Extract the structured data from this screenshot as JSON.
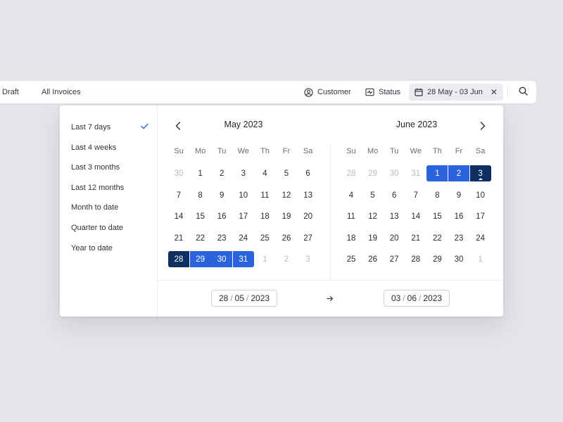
{
  "topbar": {
    "draft_label": "Draft",
    "all_invoices_label": "All Invoices",
    "customer_label": "Customer",
    "status_label": "Status",
    "date_chip_label": "28 May - 03 Jun",
    "clear_label": "✕",
    "icons": {
      "customer": "user-circle-icon",
      "status": "pulse-icon",
      "date": "calendar-icon",
      "clear": "close-icon",
      "search": "search-icon"
    }
  },
  "presets": [
    {
      "label": "Last 7 days",
      "selected": true
    },
    {
      "label": "Last 4 weeks",
      "selected": false
    },
    {
      "label": "Last 3 months",
      "selected": false
    },
    {
      "label": "Last 12 months",
      "selected": false
    },
    {
      "label": "Month to date",
      "selected": false
    },
    {
      "label": "Quarter to date",
      "selected": false
    },
    {
      "label": "Year to date",
      "selected": false
    }
  ],
  "calendar": {
    "weekdays": [
      "Su",
      "Mo",
      "Tu",
      "We",
      "Th",
      "Fr",
      "Sa"
    ],
    "months": [
      {
        "title": "May 2023",
        "weeks": [
          [
            {
              "d": "30",
              "s": "muted"
            },
            {
              "d": "1",
              "s": ""
            },
            {
              "d": "2",
              "s": ""
            },
            {
              "d": "3",
              "s": ""
            },
            {
              "d": "4",
              "s": ""
            },
            {
              "d": "5",
              "s": ""
            },
            {
              "d": "6",
              "s": ""
            }
          ],
          [
            {
              "d": "7",
              "s": ""
            },
            {
              "d": "8",
              "s": ""
            },
            {
              "d": "9",
              "s": ""
            },
            {
              "d": "10",
              "s": ""
            },
            {
              "d": "11",
              "s": ""
            },
            {
              "d": "12",
              "s": ""
            },
            {
              "d": "13",
              "s": ""
            }
          ],
          [
            {
              "d": "14",
              "s": ""
            },
            {
              "d": "15",
              "s": ""
            },
            {
              "d": "16",
              "s": ""
            },
            {
              "d": "17",
              "s": ""
            },
            {
              "d": "18",
              "s": ""
            },
            {
              "d": "19",
              "s": ""
            },
            {
              "d": "20",
              "s": ""
            }
          ],
          [
            {
              "d": "21",
              "s": ""
            },
            {
              "d": "22",
              "s": ""
            },
            {
              "d": "23",
              "s": ""
            },
            {
              "d": "24",
              "s": ""
            },
            {
              "d": "25",
              "s": ""
            },
            {
              "d": "26",
              "s": ""
            },
            {
              "d": "27",
              "s": ""
            }
          ],
          [
            {
              "d": "28",
              "s": "start"
            },
            {
              "d": "29",
              "s": "range"
            },
            {
              "d": "30",
              "s": "range"
            },
            {
              "d": "31",
              "s": "range-end"
            },
            {
              "d": "1",
              "s": "muted"
            },
            {
              "d": "2",
              "s": "muted"
            },
            {
              "d": "3",
              "s": "muted"
            }
          ]
        ]
      },
      {
        "title": "June 2023",
        "weeks": [
          [
            {
              "d": "28",
              "s": "muted"
            },
            {
              "d": "29",
              "s": "muted"
            },
            {
              "d": "30",
              "s": "muted"
            },
            {
              "d": "31",
              "s": "muted"
            },
            {
              "d": "1",
              "s": "range-start"
            },
            {
              "d": "2",
              "s": "range"
            },
            {
              "d": "3",
              "s": "end-today"
            }
          ],
          [
            {
              "d": "4",
              "s": ""
            },
            {
              "d": "5",
              "s": ""
            },
            {
              "d": "6",
              "s": ""
            },
            {
              "d": "7",
              "s": ""
            },
            {
              "d": "8",
              "s": ""
            },
            {
              "d": "9",
              "s": ""
            },
            {
              "d": "10",
              "s": ""
            }
          ],
          [
            {
              "d": "11",
              "s": ""
            },
            {
              "d": "12",
              "s": ""
            },
            {
              "d": "13",
              "s": ""
            },
            {
              "d": "14",
              "s": ""
            },
            {
              "d": "15",
              "s": ""
            },
            {
              "d": "16",
              "s": ""
            },
            {
              "d": "17",
              "s": ""
            }
          ],
          [
            {
              "d": "18",
              "s": ""
            },
            {
              "d": "19",
              "s": ""
            },
            {
              "d": "20",
              "s": ""
            },
            {
              "d": "21",
              "s": ""
            },
            {
              "d": "22",
              "s": ""
            },
            {
              "d": "23",
              "s": ""
            },
            {
              "d": "24",
              "s": ""
            }
          ],
          [
            {
              "d": "25",
              "s": ""
            },
            {
              "d": "26",
              "s": ""
            },
            {
              "d": "27",
              "s": ""
            },
            {
              "d": "28",
              "s": ""
            },
            {
              "d": "29",
              "s": ""
            },
            {
              "d": "30",
              "s": ""
            },
            {
              "d": "1",
              "s": "muted"
            }
          ]
        ]
      }
    ]
  },
  "inputs": {
    "start": {
      "day": "28",
      "month": "05",
      "year": "2023"
    },
    "end": {
      "day": "03",
      "month": "06",
      "year": "2023"
    },
    "separator": "/"
  },
  "colors": {
    "range": "#2b63df",
    "endpoint": "#0e2f62",
    "check": "#2b63df"
  }
}
